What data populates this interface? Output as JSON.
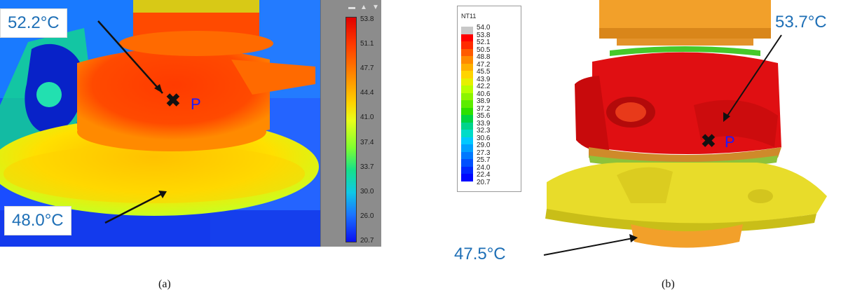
{
  "panel_a": {
    "caption": "(a)",
    "label_top": "52.2°C",
    "label_bottom": "48.0°C",
    "point_label": "P",
    "scale_ticks": [
      "53.8",
      "51.1",
      "47.7",
      "44.4",
      "41.0",
      "37.4",
      "33.7",
      "30.0",
      "26.0",
      "20.7"
    ]
  },
  "panel_b": {
    "caption": "(b)",
    "legend_title": "NT11",
    "legend_values": [
      "54.0",
      "53.8",
      "52.1",
      "50.5",
      "48.8",
      "47.2",
      "45.5",
      "43.9",
      "42.2",
      "40.6",
      "38.9",
      "37.2",
      "35.6",
      "33.9",
      "32.3",
      "30.6",
      "29.0",
      "27.3",
      "25.7",
      "24.0",
      "22.4",
      "20.7"
    ],
    "legend_colors": [
      "#c8c8c8",
      "#ff0000",
      "#ff2b00",
      "#ff5a00",
      "#ff8a00",
      "#ffb000",
      "#ffd400",
      "#e6f000",
      "#b8ff00",
      "#8cf400",
      "#5cec00",
      "#2de000",
      "#00d442",
      "#00d48c",
      "#00dcc8",
      "#00c8ff",
      "#00a0ff",
      "#0078ff",
      "#0050ff",
      "#0028ff",
      "#0008ff",
      "#0000e0"
    ],
    "label_top": "53.7°C",
    "label_bottom": "47.5°C",
    "point_label": "P"
  }
}
